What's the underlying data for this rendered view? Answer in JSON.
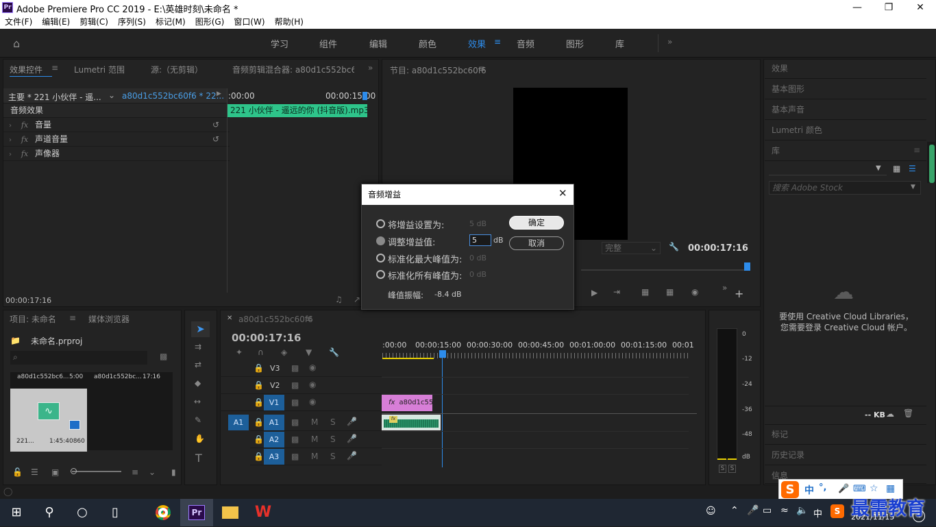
{
  "app": {
    "title": "Adobe Premiere Pro CC 2019 - E:\\英雄时刻\\未命名 *",
    "logo": "Pr"
  },
  "menu": [
    "文件(F)",
    "编辑(E)",
    "剪辑(C)",
    "序列(S)",
    "标记(M)",
    "图形(G)",
    "窗口(W)",
    "帮助(H)"
  ],
  "workspaces": [
    "学习",
    "组件",
    "编辑",
    "颜色",
    "效果",
    "音频",
    "图形",
    "库"
  ],
  "active_workspace": "效果",
  "source_panel": {
    "tabs": [
      "效果控件",
      "Lumetri 范围",
      "源:（无剪辑）",
      "音频剪辑混合器: a80d1c552bc60"
    ],
    "master": "主要 * 221 小伙伴 - 遥...",
    "clip": "a80d1c552bc60f6 * 22...",
    "time_start": ":00:00",
    "time_end": "00:00:15:00",
    "clip_label": "221 小伙伴 - 遥远的你 (抖音版).mp3",
    "section": "音频效果",
    "effects": [
      "音量",
      "声道音量",
      "声像器"
    ],
    "timecode": "00:00:17:16"
  },
  "program_panel": {
    "title": "节目: a80d1c552bc60f6",
    "fit": "完整",
    "timecode": "00:00:17:16"
  },
  "project_panel": {
    "tabs": [
      "项目: 未命名",
      "媒体浏览器"
    ],
    "file": "未命名.prproj",
    "items": [
      {
        "name": "a80d1c552bc6...",
        "duration": "5:00"
      },
      {
        "name": "a80d1c552bc...",
        "duration": "17:16"
      }
    ],
    "audio_item": {
      "name": "221...",
      "duration": "1:45:40860"
    }
  },
  "timeline": {
    "tab": "a80d1c552bc60f6",
    "timecode": "00:00:17:16",
    "ruler": [
      ":00:00",
      "00:00:15:00",
      "00:00:30:00",
      "00:00:45:00",
      "00:01:00:00",
      "00:01:15:00",
      "00:01"
    ],
    "video_tracks": [
      "V3",
      "V2",
      "V1"
    ],
    "audio_tracks": [
      "A1",
      "A2",
      "A3"
    ],
    "source_patch": "A1",
    "video_clip": "a80d1c55",
    "mute": "M",
    "solo": "S"
  },
  "meter": {
    "scale": [
      "0",
      "-12",
      "-24",
      "-36",
      "-48",
      "dB"
    ],
    "buttons": [
      "S",
      "S"
    ]
  },
  "right_panel": {
    "items": [
      "效果",
      "基本图形",
      "基本声音",
      "Lumetri 颜色",
      "库"
    ],
    "search_placeholder": "搜索 Adobe Stock",
    "cc_message": "要使用 Creative Cloud Libraries，您需要登录 Creative Cloud 帐户。",
    "kb": "-- KB",
    "bottom_items": [
      "标记",
      "历史记录",
      "信息"
    ]
  },
  "dialog": {
    "title": "音频增益",
    "options": [
      {
        "label": "将增益设置为:",
        "value": "5 dB"
      },
      {
        "label": "调整增益值:",
        "value": "5",
        "unit": "dB"
      },
      {
        "label": "标准化最大峰值为:",
        "value": "0 dB"
      },
      {
        "label": "标准化所有峰值为:",
        "value": "0 dB"
      }
    ],
    "peak_label": "峰值振幅:",
    "peak_value": "-8.4 dB",
    "ok": "确定",
    "cancel": "取消"
  },
  "ime": {
    "s": "S",
    "mode": "中",
    "dots": "°,"
  },
  "taskbar": {
    "tray_lang": "中",
    "date": "2021/11/15",
    "notif": "4"
  },
  "watermark": "最需教育"
}
